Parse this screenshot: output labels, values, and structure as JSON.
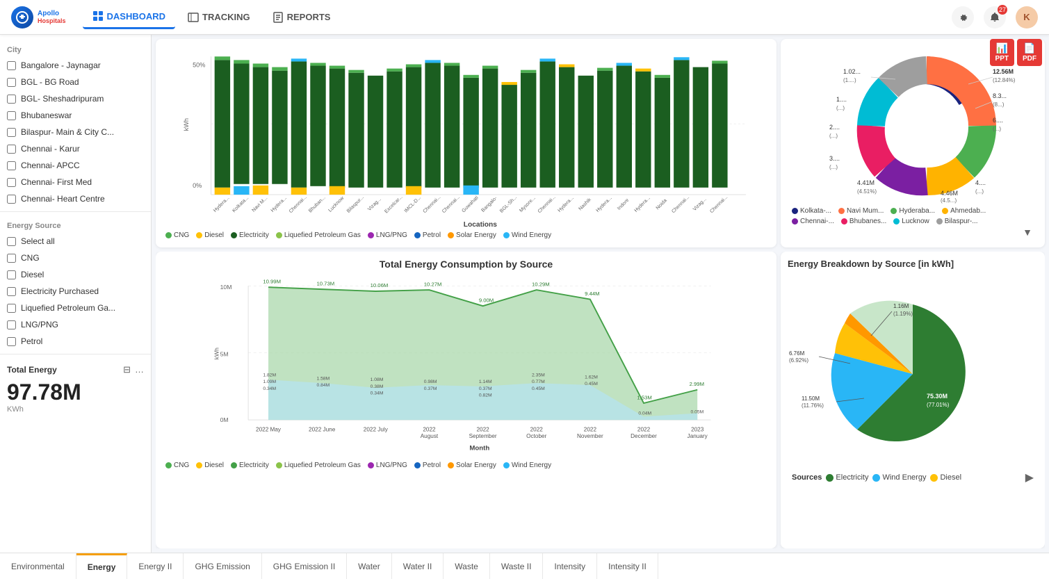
{
  "app": {
    "logo_initials": "A",
    "logo_text_line1": "Apollo",
    "logo_text_line2": "Hospitals"
  },
  "nav": {
    "items": [
      {
        "label": "DASHBOARD",
        "active": true
      },
      {
        "label": "TRACKING",
        "active": false
      },
      {
        "label": "REPORTS",
        "active": false
      }
    ]
  },
  "tabs": [
    {
      "label": "Environmental"
    },
    {
      "label": "Energy",
      "active": true
    },
    {
      "label": "Energy II"
    },
    {
      "label": "GHG Emission"
    },
    {
      "label": "GHG Emission II"
    },
    {
      "label": "Water"
    },
    {
      "label": "Water II"
    },
    {
      "label": "Waste"
    },
    {
      "label": "Waste II"
    },
    {
      "label": "Intensity"
    },
    {
      "label": "Intensity II"
    }
  ],
  "sidebar": {
    "section_city": "City",
    "cities": [
      "Bangalore - Jaynagar",
      "BGL - BG Road",
      "BGL- Sheshadripuram",
      "Bhubaneswar",
      "Bilaspur- Main & City C...",
      "Chennai - Karur",
      "Chennai- APCC",
      "Chennai- First Med",
      "Chennai- Heart Centre"
    ],
    "section_energy": "Energy Source",
    "energy_sources": [
      {
        "label": "Select all",
        "bold": true
      },
      {
        "label": "CNG"
      },
      {
        "label": "Diesel"
      },
      {
        "label": "Electricity Purchased"
      },
      {
        "label": "Liquefied Petroleum Ga..."
      },
      {
        "label": "LNG/PNG"
      },
      {
        "label": "Petrol"
      }
    ],
    "total_label": "Total Energy",
    "total_value": "97.78M",
    "total_unit": "KWh"
  },
  "bar_chart": {
    "title": "Locations",
    "y_labels": [
      "0%",
      "50%"
    ],
    "x_labels": [
      "Hydera...",
      "Kolkata...",
      "Navi M...",
      "Hydera...",
      "Chennai...",
      "Bhuban...",
      "Lucknow",
      "Bilaspur...",
      "Vizag...",
      "Excelcar...",
      "IMCL-D...",
      "Chennai...",
      "Chennai...",
      "Guwahati",
      "Bangalo-",
      "BGL-Sh...",
      "Mysore...",
      "Chennai...",
      "Hydera...",
      "Nashik",
      "Hydera...",
      "Indore",
      "Hydera...",
      "Noida",
      "Chennai...",
      "Vizag...",
      "Chennai..."
    ],
    "y_axis_label": "kWh",
    "legend": [
      {
        "label": "CNG",
        "color": "#4caf50"
      },
      {
        "label": "Diesel",
        "color": "#ffc107"
      },
      {
        "label": "Electricity",
        "color": "#1b5e20"
      },
      {
        "label": "Liquefied Petroleum Gas",
        "color": "#8bc34a"
      },
      {
        "label": "LNG/PNG",
        "color": "#9c27b0"
      },
      {
        "label": "Petrol",
        "color": "#1565c0"
      },
      {
        "label": "Solar Energy",
        "color": "#ff9800"
      },
      {
        "label": "Wind Energy",
        "color": "#29b6f6"
      }
    ]
  },
  "donut_chart": {
    "legend_items": [
      {
        "label": "Kolkata-...",
        "color": "#1a237e"
      },
      {
        "label": "Navi Mum...",
        "color": "#ff7043"
      },
      {
        "label": "Hyderaba...",
        "color": "#4caf50"
      },
      {
        "label": "Ahmedab...",
        "color": "#ffb300"
      },
      {
        "label": "Chennai-...",
        "color": "#7b1fa2"
      },
      {
        "label": "Bhubanes...",
        "color": "#e91e63"
      },
      {
        "label": "Lucknow",
        "color": "#00bcd4"
      },
      {
        "label": "Bilaspur-...",
        "color": "#9e9e9e"
      }
    ],
    "labels": [
      {
        "value": "12.56M",
        "pct": "(12.84%)"
      },
      {
        "value": "8.3...",
        "pct": "(8...)"
      },
      {
        "value": "6....",
        "pct": "(...)"
      },
      {
        "value": "1.02...",
        "pct": "(1....)"
      },
      {
        "value": "1....",
        "pct": "(...)"
      },
      {
        "value": "2....",
        "pct": "(...)"
      },
      {
        "value": "3....",
        "pct": "(...)"
      },
      {
        "value": "4.41M",
        "pct": "(4.51%)"
      },
      {
        "value": "4.46M",
        "pct": "(4.5...)"
      },
      {
        "value": "4....",
        "pct": "(...)"
      }
    ]
  },
  "line_chart": {
    "title": "Total Energy Consumption by Source",
    "x_labels": [
      "2022 May",
      "2022 June",
      "2022 July",
      "2022 August",
      "2022 September",
      "2022 October",
      "2022 November",
      "2022 December",
      "2023 January"
    ],
    "x_axis_label": "Month",
    "y_axis_label": "kWh",
    "y_labels": [
      "0M",
      "5M",
      "10M"
    ],
    "data_points": [
      {
        "month": "2022 May",
        "total": 10.99,
        "labels": [
          "10.99M",
          "1.82M",
          "1.09M",
          "0.34M"
        ]
      },
      {
        "month": "2022 June",
        "total": 10.73,
        "labels": [
          "10.73M",
          "1.58M",
          "0.84M"
        ]
      },
      {
        "month": "2022 July",
        "total": 10.06,
        "labels": [
          "10.06M",
          "1.08M",
          "0.38M",
          "0.34M"
        ]
      },
      {
        "month": "2022 August",
        "total": 10.27,
        "labels": [
          "10.27M",
          "0.98M",
          "0.37M"
        ]
      },
      {
        "month": "2022 September",
        "total": 9.0,
        "labels": [
          "9.00M",
          "1.14M",
          "0.37M",
          "0.82M"
        ]
      },
      {
        "month": "2022 October",
        "total": 10.29,
        "labels": [
          "10.29M",
          "2.35M",
          "0.77M",
          "0.45M"
        ]
      },
      {
        "month": "2022 November",
        "total": 9.44,
        "labels": [
          "9.44M",
          "1.62M",
          "0.45M"
        ]
      },
      {
        "month": "2022 December",
        "total": 1.53,
        "labels": [
          "1.53M",
          "0.04M"
        ]
      },
      {
        "month": "2023 January",
        "total": 2.99,
        "labels": [
          "2.99M",
          "0.05M"
        ]
      }
    ],
    "legend": [
      {
        "label": "CNG",
        "color": "#4caf50"
      },
      {
        "label": "Diesel",
        "color": "#ffc107"
      },
      {
        "label": "Electricity",
        "color": "#43a047"
      },
      {
        "label": "Liquefied Petroleum Gas",
        "color": "#8bc34a"
      },
      {
        "label": "LNG/PNG",
        "color": "#9c27b0"
      },
      {
        "label": "Petrol",
        "color": "#1565c0"
      },
      {
        "label": "Solar Energy",
        "color": "#ff9800"
      },
      {
        "label": "Wind Energy",
        "color": "#29b6f6"
      }
    ]
  },
  "pie_chart": {
    "title": "Energy Breakdown by Source [in kWh]",
    "segments": [
      {
        "label": "Electricity",
        "pct": 77.01,
        "value": "75.30M",
        "color": "#2e7d32"
      },
      {
        "label": "Wind Energy",
        "pct": 11.76,
        "value": "11.50M",
        "color": "#29b6f6"
      },
      {
        "label": "Diesel",
        "pct": 6.92,
        "value": "6.76M",
        "color": "#ffc107"
      },
      {
        "label": "CNG",
        "pct": 1.19,
        "value": "1.16M",
        "color": "#ff9800"
      }
    ],
    "labels": [
      {
        "text": "75.30M",
        "sub": "(77.01%)"
      },
      {
        "text": "11.50M",
        "sub": "(11.76%)"
      },
      {
        "text": "6.76M",
        "sub": "(6.92%)"
      },
      {
        "text": "1.16M",
        "sub": "(1.19%)"
      }
    ],
    "legend": [
      {
        "label": "Electricity",
        "color": "#2e7d32"
      },
      {
        "label": "Wind Energy",
        "color": "#29b6f6"
      },
      {
        "label": "Diesel",
        "color": "#ffc107"
      }
    ]
  },
  "notification_badge": "27",
  "avatar_letter": "K",
  "export_buttons": [
    {
      "label": "PPT",
      "type": "ppt"
    },
    {
      "label": "PDF",
      "type": "pdf"
    }
  ]
}
